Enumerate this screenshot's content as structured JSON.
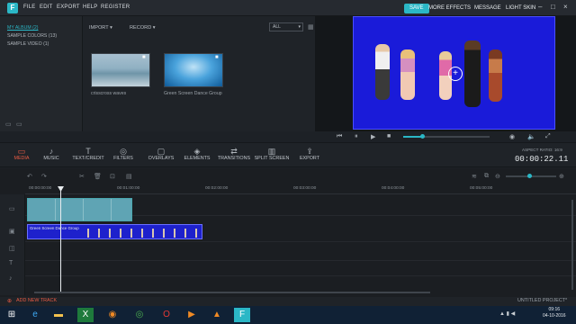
{
  "app": {
    "logo": "F",
    "menu": [
      "FILE",
      "EDIT",
      "EXPORT",
      "HELP",
      "REGISTER"
    ],
    "right_buttons": [
      "SAVE",
      "MORE EFFECTS",
      "MESSAGE",
      "LIGHT SKIN"
    ]
  },
  "albums": [
    "MY ALBUM (2)",
    "SAMPLE COLORS (13)",
    "SAMPLE VIDEO (1)"
  ],
  "media": {
    "import_label": "IMPORT",
    "record_label": "RECORD",
    "filter_value": "ALL",
    "items": [
      {
        "caption": "crisscross waves"
      },
      {
        "caption": "Green Screen Dance Group"
      }
    ]
  },
  "toolbar": {
    "tools": [
      "MEDIA",
      "MUSIC",
      "TEXT/CREDIT",
      "FILTERS",
      "OVERLAYS",
      "ELEMENTS",
      "TRANSITIONS",
      "SPLIT SCREEN",
      "EXPORT"
    ],
    "aspect_ratio": "ASPECT RATIO: 16:9",
    "timecode": "00:00:22.11"
  },
  "timeline": {
    "ruler": [
      "00:00:00:00",
      "00:01:00:00",
      "00:02:00:00",
      "00:03:00:00",
      "00:04:00:00",
      "00:05:00:00"
    ],
    "clip2_label": "Green Screen Dance Group",
    "add_track": "ADD NEW TRACK",
    "project_name": "UNTITLED PROJECT*"
  },
  "clock": {
    "time": "09:16",
    "date": "04-10-2016"
  },
  "colors": {
    "accent": "#2bb7c6",
    "active_tool": "#e85b44",
    "chroma": "#1a1bd9"
  }
}
